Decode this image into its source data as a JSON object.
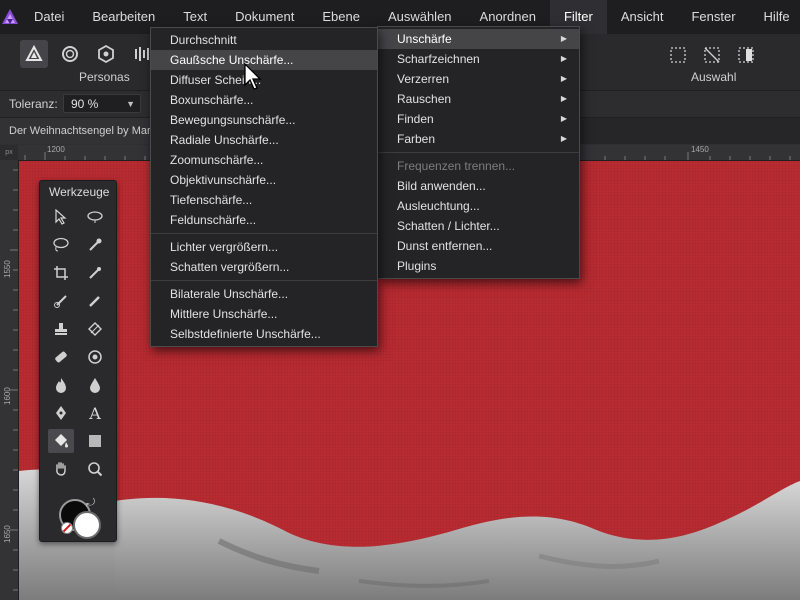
{
  "menubar": {
    "items": [
      "Datei",
      "Bearbeiten",
      "Text",
      "Dokument",
      "Ebene",
      "Auswählen",
      "Anordnen",
      "Filter",
      "Ansicht",
      "Fenster",
      "Hilfe"
    ],
    "active_index": 7
  },
  "toolbar": {
    "personas_label": "Personas",
    "auswahl_label": "Auswahl"
  },
  "context": {
    "tolerance_label": "Toleranz:",
    "tolerance_value": "90 %"
  },
  "document": {
    "tab_title": "Der Weihnachtsengel by Mar"
  },
  "ruler": {
    "top_labels": [
      "1200",
      "1450"
    ],
    "left_labels": [
      "1550",
      "1600",
      "1650"
    ],
    "unit": "px"
  },
  "tools_panel": {
    "title": "Werkzeuge"
  },
  "filter_menu": {
    "items": [
      {
        "label": "Unschärfe",
        "submenu": true,
        "highlighted": true
      },
      {
        "label": "Scharfzeichnen",
        "submenu": true
      },
      {
        "label": "Verzerren",
        "submenu": true
      },
      {
        "label": "Rauschen",
        "submenu": true
      },
      {
        "label": "Finden",
        "submenu": true
      },
      {
        "label": "Farben",
        "submenu": true
      },
      {
        "label": "Frequenzen trennen...",
        "disabled": true
      },
      {
        "label": "Bild anwenden..."
      },
      {
        "label": "Ausleuchtung..."
      },
      {
        "label": "Schatten / Lichter..."
      },
      {
        "label": "Dunst entfernen..."
      },
      {
        "label": "Plugins"
      }
    ]
  },
  "blur_menu": {
    "items": [
      "Durchschnitt",
      "Gaußsche Unschärfe...",
      "Diffuser Schein...",
      "Boxunschärfe...",
      "Bewegungsunschärfe...",
      "Radiale Unschärfe...",
      "Zoomunschärfe...",
      "Objektivunschärfe...",
      "Tiefenschärfe...",
      "Feldunschärfe...",
      "Lichter vergrößern...",
      "Schatten vergrößern...",
      "Bilaterale Unschärfe...",
      "Mittlere Unschärfe...",
      "Selbstdefinierte Unschärfe..."
    ],
    "highlighted_index": 1
  },
  "colors": {
    "canvas_red": "#b82b31",
    "menubar_bg": "#1e1e20",
    "menu_bg": "#242426",
    "menu_highlight": "#454548",
    "accent_purple": "#8a4dd6"
  }
}
